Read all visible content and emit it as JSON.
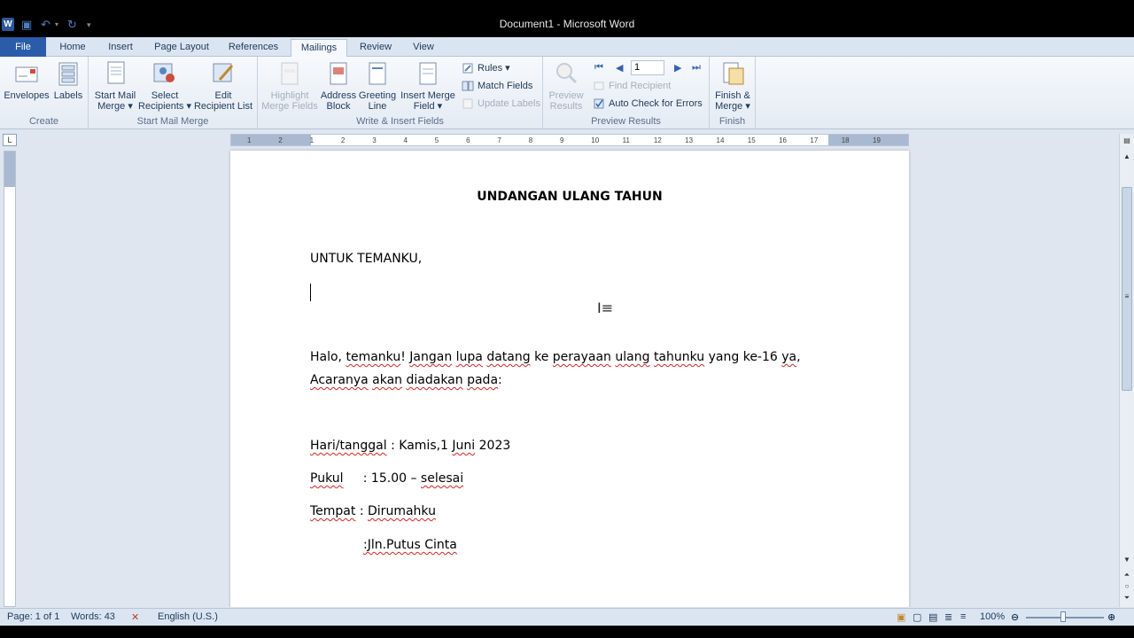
{
  "window": {
    "title": "Document1 - Microsoft Word"
  },
  "tabs": [
    {
      "label": "File"
    },
    {
      "label": "Home"
    },
    {
      "label": "Insert"
    },
    {
      "label": "Page Layout"
    },
    {
      "label": "References"
    },
    {
      "label": "Mailings"
    },
    {
      "label": "Review"
    },
    {
      "label": "View"
    }
  ],
  "active_tab": "Mailings",
  "ribbon": {
    "create": {
      "label": "Create",
      "envelopes": "Envelopes",
      "labels": "Labels"
    },
    "start_mail_merge": {
      "label": "Start Mail Merge",
      "start_l1": "Start Mail",
      "start_l2": "Merge ▾",
      "select_l1": "Select",
      "select_l2": "Recipients ▾",
      "edit_l1": "Edit",
      "edit_l2": "Recipient List"
    },
    "write_insert": {
      "label": "Write & Insert Fields",
      "highlight_l1": "Highlight",
      "highlight_l2": "Merge Fields",
      "address_l1": "Address",
      "address_l2": "Block",
      "greeting_l1": "Greeting",
      "greeting_l2": "Line",
      "insert_l1": "Insert Merge",
      "insert_l2": "Field ▾",
      "rules": "Rules ▾",
      "match_fields": "Match Fields",
      "update_labels": "Update Labels"
    },
    "preview": {
      "label": "Preview Results",
      "preview_l1": "Preview",
      "preview_l2": "Results",
      "record_value": "1",
      "find_recipient": "Find Recipient",
      "auto_check": "Auto Check for Errors"
    },
    "finish": {
      "label": "Finish",
      "finish_l1": "Finish &",
      "finish_l2": "Merge ▾"
    }
  },
  "ruler_marks": [
    "1",
    "2",
    "1",
    "2",
    "3",
    "4",
    "5",
    "6",
    "7",
    "8",
    "9",
    "10",
    "11",
    "12",
    "13",
    "14",
    "15",
    "16",
    "17",
    "18",
    "19"
  ],
  "document": {
    "title": "UNDANGAN ULANG TAHUN",
    "greeting": "UNTUK TEMANKU,",
    "body_line1": {
      "a": "Halo, ",
      "b": "temanku",
      "c": "! ",
      "d": "Jangan",
      "e": " ",
      "f": "lupa",
      "g": " ",
      "h": "datang",
      "i": " ke ",
      "j": "perayaan",
      "k": " ",
      "l": "ulang",
      "m": " ",
      "n": "tahunku",
      "o": " yang ke-16 ",
      "p": "ya",
      "q": ","
    },
    "body_line2": {
      "a": "Acaranya",
      "b": " ",
      "c": "akan",
      "d": " ",
      "e": "diadakan",
      "f": " ",
      "g": "pada",
      "h": ":"
    },
    "day_label": "Hari/tanggal",
    "day_value": " : Kamis,1 ",
    "day_month": "Juni",
    "day_year": " 2023",
    "time_label": "Pukul",
    "time_value": "     : 15.00 – ",
    "time_end": "selesai",
    "place_label": "Tempat",
    "place_value": " : ",
    "place_name": "Dirumahku",
    "address": ":Jln.Putus Cinta"
  },
  "status": {
    "page": "Page: 1 of 1",
    "words": "Words: 43",
    "language": "English (U.S.)",
    "zoom": "100%"
  }
}
